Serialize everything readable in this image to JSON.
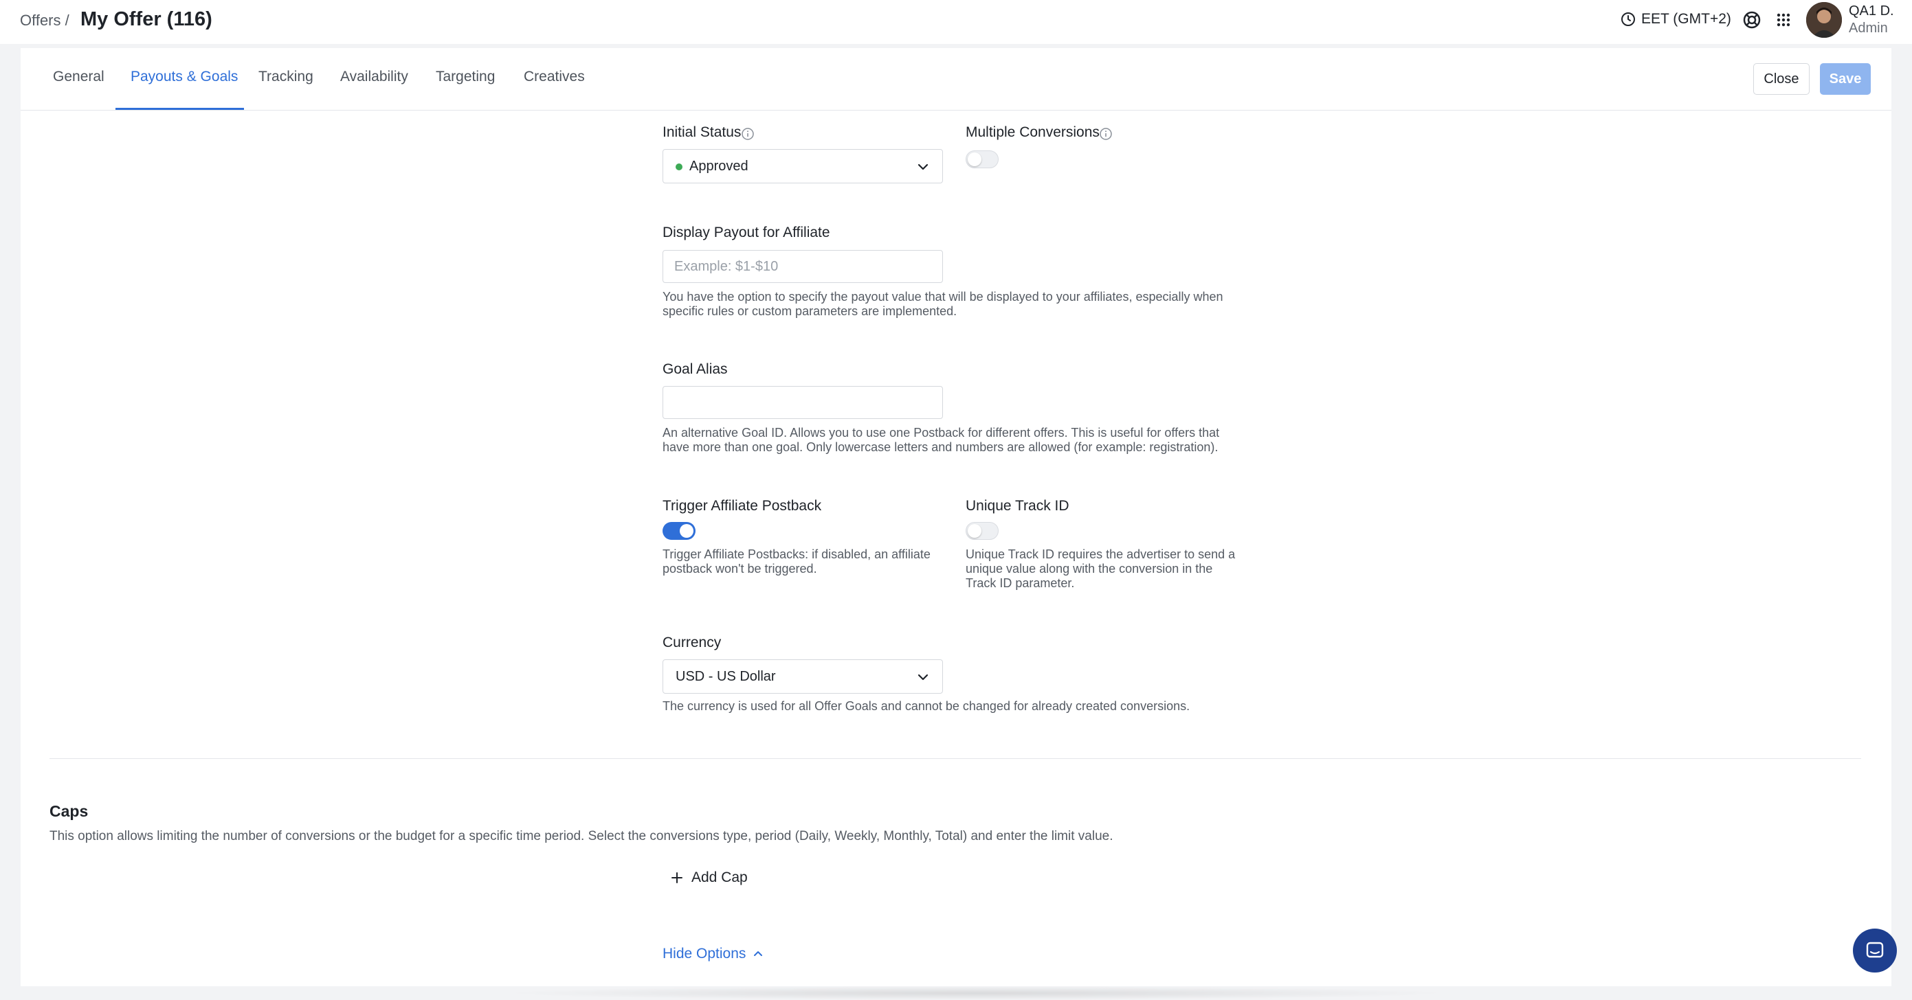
{
  "header": {
    "breadcrumb": "Offers /",
    "title": "My Offer (116)",
    "timezone": "EET (GMT+2)",
    "user_name": "QA1 D.",
    "user_role": "Admin"
  },
  "tabs": [
    {
      "label": "General",
      "active": false
    },
    {
      "label": "Payouts & Goals",
      "active": true
    },
    {
      "label": "Tracking",
      "active": false
    },
    {
      "label": "Availability",
      "active": false
    },
    {
      "label": "Targeting",
      "active": false
    },
    {
      "label": "Creatives",
      "active": false
    }
  ],
  "actions": {
    "close_label": "Close",
    "save_label": "Save"
  },
  "form": {
    "initial_status": {
      "label": "Initial Status",
      "value": "Approved",
      "status_color": "#3daa56"
    },
    "multiple_conversions": {
      "label": "Multiple Conversions",
      "enabled": false
    },
    "display_payout": {
      "label": "Display Payout for Affiliate",
      "value": "",
      "placeholder": "Example: $1-$10",
      "help_line1": "You have the option to specify the payout value that will be displayed to your affiliates, especially when",
      "help_line2": "specific rules or custom parameters are implemented."
    },
    "goal_alias": {
      "label": "Goal Alias",
      "value": "",
      "help_line1": "An alternative Goal ID. Allows you to use one Postback for different offers. This is useful for offers that",
      "help_line2": "have more than one goal. Only lowercase letters and numbers are allowed (for example: registration)."
    },
    "trigger_postback": {
      "label": "Trigger Affiliate Postback",
      "enabled": true,
      "help_line1": "Trigger Affiliate Postbacks: if disabled, an affiliate",
      "help_line2": "postback won't be triggered."
    },
    "unique_track_id": {
      "label": "Unique Track ID",
      "enabled": false,
      "help_line1": "Unique Track ID requires the advertiser to send a",
      "help_line2": "unique value along with the conversion in the",
      "help_line3": "Track ID parameter."
    },
    "currency": {
      "label": "Currency",
      "value": "USD - US Dollar",
      "help": "The currency is used for all Offer Goals and cannot be changed for already created conversions."
    }
  },
  "caps": {
    "title": "Caps",
    "description": "This option allows limiting the number of conversions or the budget for a specific time period. Select the conversions type, period (Daily, Weekly, Monthly, Total) and enter the limit value.",
    "add_label": "Add Cap"
  },
  "hide_options_label": "Hide Options",
  "colors": {
    "accent": "#2f6fd8",
    "save_disabled": "#8fb5ef",
    "chat": "#1e3f8f"
  }
}
